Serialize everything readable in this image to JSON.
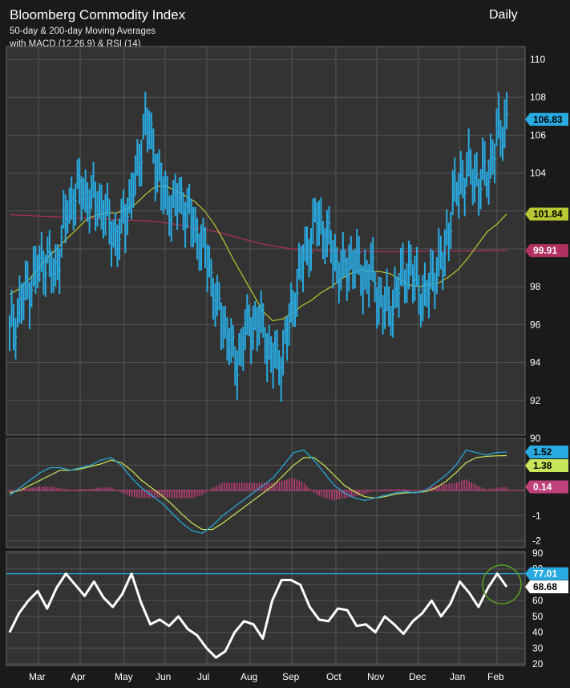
{
  "header": {
    "title": "Bloomberg Commodity Index",
    "subtitle_1": "50-day & 200-day Moving Averages",
    "subtitle_2": "with MACD (12,26,9) & RSI (14)",
    "period": "Daily"
  },
  "colors": {
    "background": "#333333",
    "grid": "#555555",
    "price": "#29abe2",
    "ma50": "#b8c832",
    "ma200": "#b03060",
    "macd": "#29abe2",
    "signal": "#c8e65a",
    "histogram": "#c0407a",
    "rsi": "#ffffff",
    "rsi_line": "#29abe2"
  },
  "chart_data": [
    {
      "type": "candlestick",
      "name": "price-panel",
      "months": [
        "Mar",
        "Apr",
        "May",
        "Jun",
        "Jul",
        "Aug",
        "Sep",
        "Oct",
        "Nov",
        "Dec",
        "Jan",
        "Feb"
      ],
      "ylim": [
        90,
        110
      ],
      "yticks": [
        90,
        92,
        94,
        96,
        98,
        100,
        102,
        104,
        106,
        108,
        110
      ],
      "grid": true,
      "series": [
        {
          "name": "price",
          "values": [
            95.5,
            96.8,
            97.9,
            98.8,
            99.6,
            98.5,
            101.2,
            102.8,
            103.1,
            102.6,
            102.5,
            101.3,
            100.4,
            102.2,
            103.6,
            106.9,
            105.1,
            102.8,
            102.3,
            102.6,
            101.6,
            100.5,
            99.3,
            96.8,
            95.8,
            93.8,
            95.5,
            96.2,
            95.9,
            94.2,
            94.0,
            96.1,
            98.6,
            100.1,
            101.6,
            100.8,
            99.4,
            98.7,
            99.6,
            98.5,
            98.8,
            97.2,
            96.7,
            97.9,
            99.1,
            98.2,
            97.3,
            98.9,
            99.3,
            102.4,
            103.7,
            104.1,
            103.5,
            104.1,
            105.9,
            106.8
          ]
        },
        {
          "name": "50-day MA",
          "values": [
            97.6,
            97.9,
            98.4,
            99.0,
            99.6,
            100.1,
            100.6,
            101.1,
            101.6,
            101.8,
            101.9,
            101.9,
            102.1,
            102.4,
            102.9,
            103.3,
            103.3,
            103.1,
            102.8,
            102.5,
            102.0,
            101.3,
            100.4,
            99.4,
            98.5,
            97.6,
            96.7,
            96.2,
            96.3,
            96.6,
            97.0,
            97.3,
            97.7,
            98.0,
            98.4,
            98.7,
            98.9,
            98.8,
            98.8,
            98.7,
            98.4,
            98.1,
            98.0,
            98.1,
            98.2,
            98.5,
            98.9,
            99.5,
            100.2,
            100.9,
            101.3,
            101.84
          ]
        },
        {
          "name": "200-day MA",
          "values": [
            101.8,
            101.75,
            101.7,
            101.65,
            101.6,
            101.55,
            101.5,
            101.45,
            101.3,
            101.1,
            100.9,
            100.6,
            100.3,
            100.1,
            99.95,
            99.9,
            99.88,
            99.86,
            99.85,
            99.85,
            99.86,
            99.87,
            99.88,
            99.9,
            99.91
          ]
        }
      ],
      "last_values": {
        "price": "106.83",
        "ma50": "101.84",
        "ma200": "99.91"
      }
    },
    {
      "type": "line",
      "name": "macd-panel",
      "ylim": [
        -2,
        2
      ],
      "yticks": [
        -2,
        -1,
        0,
        1
      ],
      "series": [
        {
          "name": "MACD",
          "values": [
            -0.2,
            0.1,
            0.4,
            0.7,
            0.9,
            0.9,
            0.8,
            0.9,
            1.0,
            1.2,
            1.3,
            1.0,
            0.5,
            0.1,
            -0.2,
            -0.5,
            -0.9,
            -1.3,
            -1.6,
            -1.7,
            -1.4,
            -1.0,
            -0.7,
            -0.4,
            -0.1,
            0.2,
            0.5,
            1.0,
            1.5,
            1.6,
            1.2,
            0.7,
            0.2,
            -0.1,
            -0.3,
            -0.4,
            -0.3,
            -0.2,
            -0.1,
            -0.05,
            -0.1,
            0.0,
            0.3,
            0.6,
            1.0,
            1.6,
            1.5,
            1.4,
            1.5,
            1.52
          ]
        },
        {
          "name": "Signal",
          "values": [
            -0.1,
            0.0,
            0.2,
            0.4,
            0.6,
            0.8,
            0.8,
            0.85,
            0.95,
            1.05,
            1.2,
            1.1,
            0.8,
            0.4,
            0.1,
            -0.2,
            -0.55,
            -0.95,
            -1.3,
            -1.55,
            -1.55,
            -1.3,
            -1.0,
            -0.7,
            -0.4,
            -0.1,
            0.2,
            0.6,
            1.0,
            1.3,
            1.3,
            1.0,
            0.6,
            0.2,
            -0.05,
            -0.25,
            -0.3,
            -0.25,
            -0.15,
            -0.1,
            -0.08,
            -0.05,
            0.1,
            0.35,
            0.7,
            1.1,
            1.3,
            1.35,
            1.37,
            1.38
          ]
        }
      ],
      "histogram": [
        -0.05,
        0.05,
        0.1,
        0.15,
        0.15,
        0.08,
        0.02,
        0.05,
        0.05,
        0.12,
        0.12,
        -0.08,
        -0.25,
        -0.3,
        -0.3,
        -0.28,
        -0.3,
        -0.32,
        -0.3,
        -0.18,
        0.1,
        0.3,
        0.3,
        0.3,
        0.3,
        0.3,
        0.3,
        0.4,
        0.5,
        0.3,
        -0.1,
        -0.3,
        -0.4,
        -0.3,
        -0.25,
        -0.15,
        0.0,
        0.05,
        0.05,
        0.05,
        -0.02,
        0.05,
        0.2,
        0.25,
        0.3,
        0.45,
        0.2,
        0.05,
        0.1,
        0.14
      ],
      "last_values": {
        "macd": "1.52",
        "signal": "1.38",
        "histogram": "0.14"
      }
    },
    {
      "type": "line",
      "name": "rsi-panel",
      "ylim": [
        20,
        90
      ],
      "yticks": [
        20,
        30,
        40,
        50,
        60,
        70,
        80,
        90
      ],
      "reference_line": 77.01,
      "series": [
        {
          "name": "RSI",
          "values": [
            40,
            52,
            60,
            66,
            55,
            68,
            77,
            70,
            63,
            72,
            62,
            56,
            64,
            77,
            59,
            45,
            48,
            44,
            50,
            42,
            38,
            30,
            24,
            28,
            40,
            47,
            45,
            36,
            60,
            73,
            73,
            70,
            56,
            48,
            47,
            55,
            54,
            44,
            45,
            40,
            50,
            45,
            39,
            47,
            52,
            60,
            50,
            58,
            72,
            65,
            56,
            68,
            77,
            68.68
          ]
        }
      ],
      "last_values": {
        "reference": "77.01",
        "rsi": "68.68"
      }
    }
  ]
}
